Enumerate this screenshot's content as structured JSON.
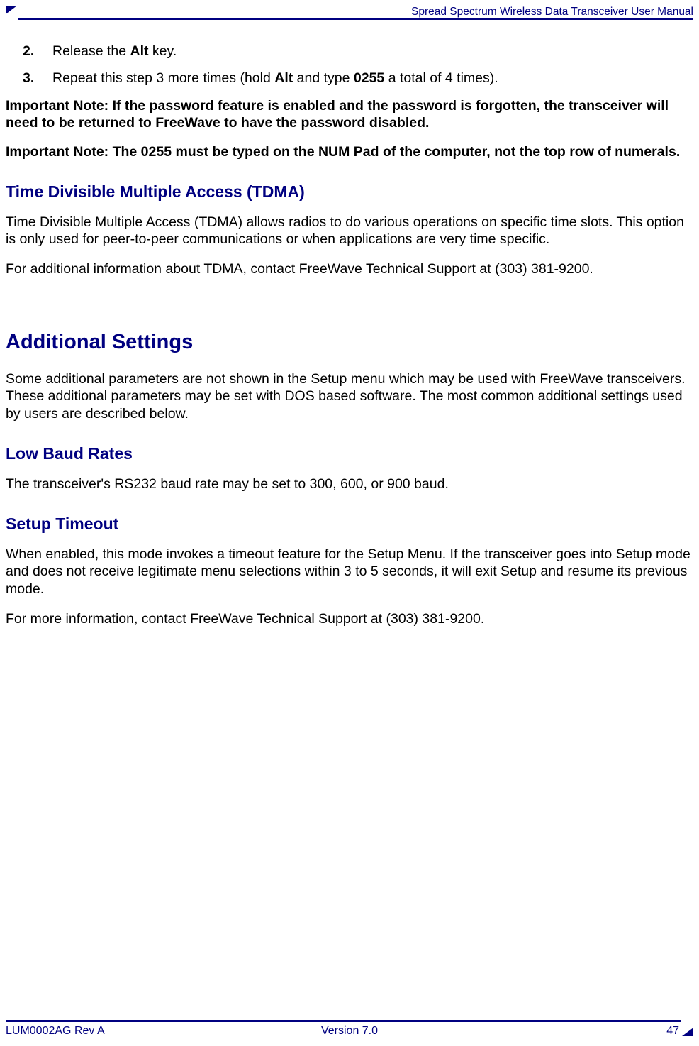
{
  "header": {
    "title": "Spread Spectrum Wireless Data Transceiver User Manual"
  },
  "steps": [
    {
      "num": "2.",
      "prefix": "Release the ",
      "bold1": "Alt",
      "suffix": " key."
    },
    {
      "num": "3.",
      "prefix": "Repeat this step 3 more times (hold ",
      "bold1": "Alt",
      "mid": " and type ",
      "bold2": "0255",
      "suffix": " a total of 4 times)."
    }
  ],
  "note1": "Important Note: If the password feature is enabled and the password is forgotten, the transceiver will need to be returned to FreeWave to have the password disabled.",
  "note2": "Important Note: The 0255 must be typed on the NUM Pad of the computer, not the top row of numerals.",
  "tdma": {
    "heading": "Time Divisible Multiple Access (TDMA)",
    "p1": "Time Divisible Multiple Access (TDMA) allows radios to do various operations on specific time slots. This option is only used for peer-to-peer communications or when applications are very time specific.",
    "p2": "For additional information about TDMA, contact FreeWave Technical Support at (303) 381-9200."
  },
  "additional": {
    "heading": "Additional Settings",
    "intro": "Some additional parameters are not shown in the Setup menu which may be used with FreeWave transceivers. These additional parameters may be set with DOS based software. The most common additional settings used by users are described below.",
    "lowbaud": {
      "heading": "Low Baud Rates",
      "p1": "The transceiver's RS232 baud rate may be set to 300, 600, or 900 baud."
    },
    "timeout": {
      "heading": "Setup Timeout",
      "p1": "When enabled, this mode invokes a timeout feature for the Setup Menu. If the transceiver goes into Setup mode and does not receive legitimate menu selections within 3 to 5 seconds, it will exit Setup and resume its previous mode.",
      "p2": "For more information, contact FreeWave Technical Support at (303) 381-9200."
    }
  },
  "footer": {
    "left": "LUM0002AG Rev A",
    "center": "Version 7.0",
    "right": "47"
  }
}
